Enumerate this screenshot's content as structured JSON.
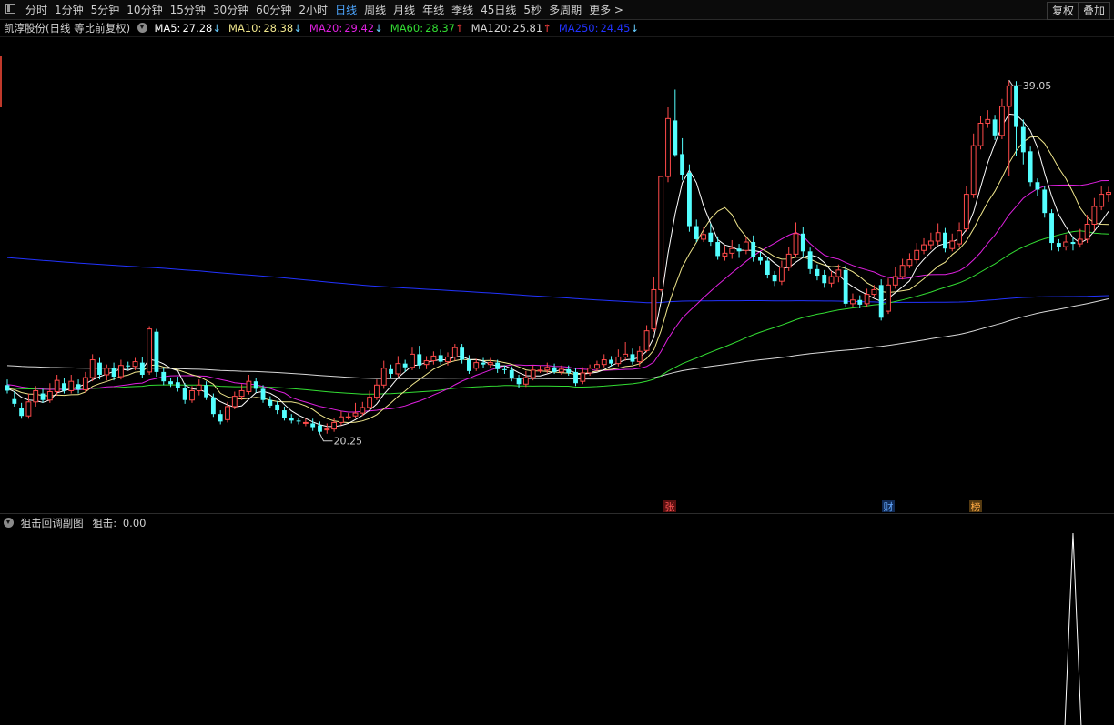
{
  "toolbar": {
    "periods": [
      "分时",
      "1分钟",
      "5分钟",
      "10分钟",
      "15分钟",
      "30分钟",
      "60分钟",
      "2小时",
      "日线",
      "周线",
      "月线",
      "年线",
      "季线",
      "45日线",
      "5秒",
      "多周期",
      "更多 >"
    ],
    "active_period": "日线",
    "fuquan_label": "复权",
    "overlay_label": "叠加"
  },
  "legend": {
    "stock_title": "凯淳股份(日线 等比前复权)",
    "ma": [
      {
        "label": "MA5:",
        "value": "27.28",
        "arrow": "↓",
        "color": "#ffffff"
      },
      {
        "label": "MA10:",
        "value": "28.38",
        "arrow": "↓",
        "color": "#f0e68c"
      },
      {
        "label": "MA20:",
        "value": "29.42",
        "arrow": "↓",
        "color": "#e020e0"
      },
      {
        "label": "MA60:",
        "value": "28.37",
        "arrow": "↑",
        "color": "#33dd33"
      },
      {
        "label": "MA120:",
        "value": "25.81",
        "arrow": "↑",
        "color": "#d8d8d8"
      },
      {
        "label": "MA250:",
        "value": "24.45",
        "arrow": "↓",
        "color": "#2233ff"
      }
    ],
    "arrow_up_color": "#ff4040",
    "arrow_down_color": "#66ccff"
  },
  "markers": [
    {
      "text": "张",
      "color": "#ff5555",
      "bg": "#5a1010"
    },
    {
      "text": "财",
      "color": "#66aaff",
      "bg": "#102a55"
    },
    {
      "text": "榜",
      "color": "#ffaa44",
      "bg": "#553a10"
    }
  ],
  "sub_panel": {
    "title": "狙击回调副图",
    "indicator_label": "狙击:",
    "indicator_value": "0.00"
  },
  "colors": {
    "up": "#ff4a4a",
    "down": "#54ffff",
    "ma5": "#ffffff",
    "ma10": "#f0e68c",
    "ma20": "#e020e0",
    "ma60": "#33dd33",
    "ma120": "#d8d8d8",
    "ma250": "#2233ff"
  },
  "chart_data": {
    "type": "candlestick",
    "price_range": [
      16.1,
      41.2
    ],
    "annotations": [
      {
        "label": "39.05",
        "value": 39.05,
        "kind": "high"
      },
      {
        "label": "20.25",
        "value": 20.25,
        "kind": "low"
      }
    ],
    "candles": [
      [
        22.75,
        22.45,
        23.05,
        22.3
      ],
      [
        22.0,
        21.75,
        22.4,
        21.6
      ],
      [
        21.5,
        21.1,
        21.8,
        20.95
      ],
      [
        21.1,
        21.85,
        22.3,
        20.95
      ],
      [
        21.85,
        22.45,
        22.7,
        21.6
      ],
      [
        22.3,
        21.95,
        22.55,
        21.8
      ],
      [
        21.95,
        22.4,
        22.85,
        21.8
      ],
      [
        22.4,
        23.0,
        23.3,
        22.2
      ],
      [
        22.85,
        22.45,
        23.15,
        22.3
      ],
      [
        22.45,
        22.95,
        23.3,
        22.3
      ],
      [
        22.8,
        22.5,
        23.05,
        22.3
      ],
      [
        22.5,
        23.15,
        23.45,
        22.35
      ],
      [
        23.15,
        24.1,
        24.4,
        22.95
      ],
      [
        23.95,
        23.3,
        24.2,
        23.05
      ],
      [
        23.3,
        23.65,
        23.85,
        23.0
      ],
      [
        23.65,
        23.2,
        23.95,
        23.0
      ],
      [
        23.2,
        23.8,
        24.1,
        23.05
      ],
      [
        23.8,
        23.75,
        24.0,
        23.55
      ],
      [
        23.75,
        24.0,
        24.2,
        23.55
      ],
      [
        23.95,
        23.3,
        24.25,
        23.15
      ],
      [
        23.45,
        25.75,
        25.9,
        23.3
      ],
      [
        25.6,
        23.45,
        25.75,
        23.2
      ],
      [
        23.45,
        22.95,
        23.7,
        22.75
      ],
      [
        22.95,
        22.8,
        23.15,
        22.65
      ],
      [
        22.9,
        22.6,
        23.2,
        22.4
      ],
      [
        22.6,
        21.95,
        22.85,
        21.75
      ],
      [
        21.95,
        22.45,
        22.7,
        21.8
      ],
      [
        22.45,
        22.75,
        23.05,
        22.2
      ],
      [
        22.75,
        22.1,
        22.95,
        21.95
      ],
      [
        22.1,
        21.2,
        22.3,
        21.05
      ],
      [
        21.2,
        20.8,
        21.4,
        20.65
      ],
      [
        20.9,
        21.6,
        21.85,
        20.75
      ],
      [
        21.6,
        22.15,
        22.4,
        21.45
      ],
      [
        22.15,
        22.45,
        22.8,
        21.95
      ],
      [
        22.4,
        22.95,
        23.3,
        22.25
      ],
      [
        22.95,
        22.55,
        23.15,
        22.35
      ],
      [
        22.55,
        21.95,
        22.75,
        21.8
      ],
      [
        21.95,
        21.65,
        22.15,
        21.5
      ],
      [
        21.7,
        21.4,
        21.9,
        21.2
      ],
      [
        21.4,
        21.0,
        21.6,
        20.85
      ],
      [
        21.0,
        20.85,
        21.2,
        20.7
      ],
      [
        20.85,
        20.8,
        21.0,
        20.65
      ],
      [
        20.75,
        20.75,
        20.95,
        20.55
      ],
      [
        20.7,
        20.5,
        20.95,
        20.3
      ],
      [
        20.6,
        20.25,
        20.8,
        20.15
      ],
      [
        20.35,
        20.4,
        20.7,
        20.15
      ],
      [
        20.4,
        20.75,
        21.0,
        20.25
      ],
      [
        20.75,
        21.05,
        21.35,
        20.6
      ],
      [
        21.05,
        21.05,
        21.25,
        20.9
      ],
      [
        21.1,
        21.25,
        21.8,
        21.0
      ],
      [
        21.25,
        21.55,
        21.85,
        21.1
      ],
      [
        21.55,
        22.1,
        22.45,
        21.4
      ],
      [
        22.1,
        22.75,
        23.05,
        21.95
      ],
      [
        22.75,
        23.65,
        24.05,
        22.55
      ],
      [
        23.6,
        23.35,
        23.85,
        23.1
      ],
      [
        23.35,
        23.9,
        24.3,
        23.2
      ],
      [
        23.9,
        23.7,
        24.1,
        23.45
      ],
      [
        23.7,
        24.4,
        24.75,
        23.55
      ],
      [
        24.4,
        23.8,
        24.85,
        23.6
      ],
      [
        23.85,
        24.05,
        24.3,
        23.6
      ],
      [
        24.05,
        24.3,
        24.55,
        23.85
      ],
      [
        24.35,
        24.0,
        24.65,
        23.85
      ],
      [
        24.0,
        24.25,
        24.5,
        23.8
      ],
      [
        24.25,
        24.75,
        24.95,
        24.05
      ],
      [
        24.75,
        24.1,
        24.95,
        23.9
      ],
      [
        24.1,
        23.5,
        24.35,
        23.35
      ],
      [
        23.65,
        23.95,
        24.15,
        23.5
      ],
      [
        23.95,
        23.85,
        24.2,
        23.65
      ],
      [
        23.85,
        23.95,
        24.2,
        23.65
      ],
      [
        23.95,
        23.6,
        24.1,
        23.4
      ],
      [
        23.6,
        23.55,
        23.8,
        23.35
      ],
      [
        23.55,
        23.15,
        23.75,
        22.95
      ],
      [
        23.15,
        22.8,
        23.3,
        22.6
      ],
      [
        22.8,
        23.15,
        23.5,
        22.65
      ],
      [
        23.15,
        23.55,
        23.8,
        23.0
      ],
      [
        23.55,
        23.55,
        23.8,
        23.4
      ],
      [
        23.55,
        23.7,
        23.95,
        23.4
      ],
      [
        23.7,
        23.45,
        23.9,
        23.35
      ],
      [
        23.45,
        23.6,
        23.8,
        23.3
      ],
      [
        23.6,
        23.4,
        23.8,
        23.25
      ],
      [
        23.45,
        22.85,
        23.65,
        22.7
      ],
      [
        22.95,
        23.4,
        23.7,
        22.8
      ],
      [
        23.4,
        23.65,
        23.85,
        23.25
      ],
      [
        23.65,
        23.85,
        24.05,
        23.5
      ],
      [
        23.85,
        24.1,
        24.4,
        23.7
      ],
      [
        24.1,
        23.9,
        24.3,
        23.75
      ],
      [
        23.9,
        24.25,
        24.65,
        23.75
      ],
      [
        24.25,
        24.4,
        25.05,
        24.05
      ],
      [
        24.4,
        24.0,
        24.7,
        23.85
      ],
      [
        24.0,
        24.55,
        24.85,
        23.75
      ],
      [
        24.6,
        25.65,
        25.95,
        24.5
      ],
      [
        25.75,
        27.85,
        28.55,
        25.6
      ],
      [
        27.85,
        33.9,
        33.95,
        27.75
      ],
      [
        33.9,
        37.0,
        37.6,
        33.6
      ],
      [
        36.9,
        35.05,
        38.55,
        34.95
      ],
      [
        35.1,
        34.0,
        35.95,
        33.7
      ],
      [
        34.1,
        31.25,
        34.55,
        30.95
      ],
      [
        31.25,
        30.55,
        31.6,
        30.4
      ],
      [
        30.55,
        30.8,
        31.2,
        30.4
      ],
      [
        30.9,
        30.4,
        31.4,
        30.2
      ],
      [
        30.4,
        29.65,
        30.7,
        29.45
      ],
      [
        29.65,
        29.8,
        30.2,
        29.4
      ],
      [
        29.8,
        30.05,
        30.5,
        29.5
      ],
      [
        30.05,
        29.9,
        30.3,
        29.55
      ],
      [
        29.95,
        30.4,
        30.7,
        29.75
      ],
      [
        30.4,
        29.6,
        30.75,
        29.35
      ],
      [
        29.6,
        29.4,
        29.85,
        29.2
      ],
      [
        29.4,
        28.65,
        29.6,
        28.45
      ],
      [
        28.65,
        28.3,
        28.85,
        28.05
      ],
      [
        28.3,
        29.05,
        29.4,
        28.1
      ],
      [
        29.05,
        29.75,
        30.15,
        28.85
      ],
      [
        29.75,
        30.85,
        31.45,
        29.6
      ],
      [
        30.85,
        29.9,
        31.2,
        29.6
      ],
      [
        29.9,
        28.95,
        30.1,
        28.7
      ],
      [
        28.95,
        28.6,
        29.2,
        28.35
      ],
      [
        28.65,
        28.2,
        28.9,
        27.95
      ],
      [
        28.2,
        28.55,
        28.85,
        27.95
      ],
      [
        28.55,
        28.9,
        29.2,
        28.25
      ],
      [
        28.9,
        27.1,
        29.15,
        26.95
      ],
      [
        27.1,
        27.3,
        27.65,
        26.9
      ],
      [
        27.3,
        27.05,
        27.55,
        26.85
      ],
      [
        27.1,
        27.6,
        27.9,
        26.95
      ],
      [
        27.6,
        27.85,
        28.1,
        27.45
      ],
      [
        28.1,
        26.35,
        28.4,
        26.2
      ],
      [
        26.7,
        28.1,
        28.45,
        26.55
      ],
      [
        28.1,
        28.55,
        29.05,
        27.9
      ],
      [
        28.55,
        29.15,
        29.5,
        28.4
      ],
      [
        29.15,
        29.45,
        29.8,
        29.0
      ],
      [
        29.45,
        29.95,
        30.35,
        29.25
      ],
      [
        29.95,
        30.25,
        30.6,
        29.75
      ],
      [
        30.25,
        30.45,
        30.9,
        30.0
      ],
      [
        30.45,
        30.9,
        31.4,
        30.25
      ],
      [
        30.9,
        30.05,
        31.15,
        29.85
      ],
      [
        30.05,
        30.45,
        30.85,
        29.9
      ],
      [
        30.3,
        31.0,
        31.45,
        30.1
      ],
      [
        31.1,
        32.95,
        33.4,
        30.95
      ],
      [
        32.95,
        35.55,
        36.2,
        32.75
      ],
      [
        35.55,
        36.75,
        37.15,
        35.35
      ],
      [
        36.75,
        36.95,
        37.45,
        36.5
      ],
      [
        36.95,
        36.1,
        37.2,
        35.85
      ],
      [
        36.1,
        37.65,
        38.05,
        35.9
      ],
      [
        37.65,
        38.75,
        39.05,
        33.95
      ],
      [
        38.75,
        36.55,
        39.0,
        35.0
      ],
      [
        36.55,
        35.2,
        36.95,
        34.55
      ],
      [
        35.25,
        33.6,
        35.5,
        33.35
      ],
      [
        33.6,
        33.2,
        33.8,
        32.85
      ],
      [
        33.2,
        31.95,
        33.4,
        31.7
      ],
      [
        31.95,
        30.35,
        32.15,
        29.95
      ],
      [
        30.35,
        30.15,
        30.55,
        29.9
      ],
      [
        30.15,
        30.4,
        30.8,
        29.95
      ],
      [
        30.4,
        30.3,
        30.7,
        29.95
      ],
      [
        30.3,
        30.55,
        31.1,
        30.1
      ],
      [
        30.55,
        31.35,
        31.85,
        30.35
      ],
      [
        31.35,
        32.3,
        32.75,
        31.0
      ],
      [
        32.3,
        32.95,
        33.4,
        32.1
      ],
      [
        32.95,
        33.05,
        33.35,
        32.55
      ]
    ],
    "sub_series": {
      "name": "狙击",
      "spike_index": 150,
      "spike_value": 1,
      "baseline": 0
    }
  }
}
